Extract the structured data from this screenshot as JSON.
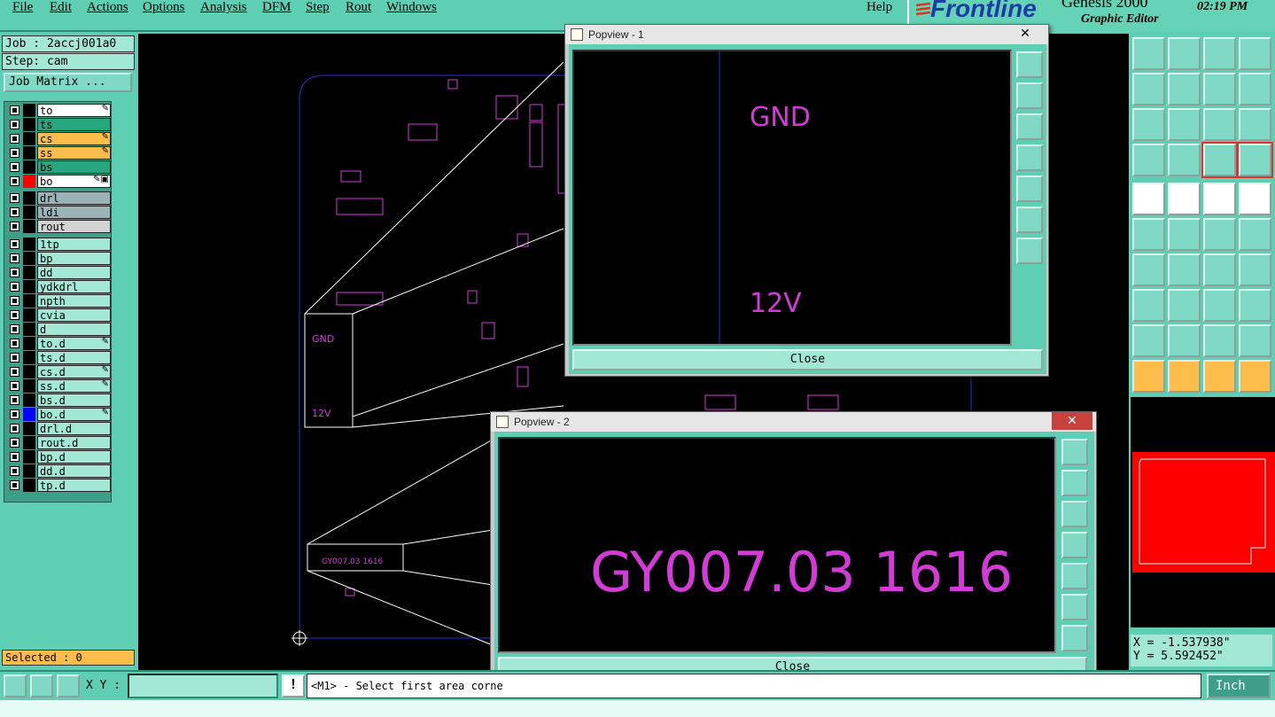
{
  "menu": {
    "items": [
      "File",
      "Edit",
      "Actions",
      "Options",
      "Analysis",
      "DFM",
      "Step",
      "Rout",
      "Windows"
    ],
    "help": "Help"
  },
  "brand": {
    "logo": "Frontline",
    "product": "Genesis 2000",
    "subtitle": "Graphic Editor",
    "time": "02:19 PM"
  },
  "job": {
    "job_label": "Job : 2accj001a0",
    "step_label": "Step: cam",
    "matrix_button": "Job Matrix ..."
  },
  "layers": [
    {
      "name": "to",
      "color": "#ffffff",
      "bg": "#ffffff",
      "tag": "✎"
    },
    {
      "name": "ts",
      "color": "#ffffff",
      "bg": "#25a67d",
      "tag": ""
    },
    {
      "name": "cs",
      "color": "#ffffff",
      "bg": "#fdbd4a",
      "tag": "✎"
    },
    {
      "name": "ss",
      "color": "#ffffff",
      "bg": "#fdbd4a",
      "tag": "✎"
    },
    {
      "name": "bs",
      "color": "#ffffff",
      "bg": "#25a67d",
      "tag": ""
    },
    {
      "name": "bo",
      "color": "#ff0000",
      "bg": "#ffffff",
      "tag": "✎▣"
    },
    {
      "name": "drl",
      "color": "#ffffff",
      "bg": "#9bb3b7",
      "tag": ""
    },
    {
      "name": "ldi",
      "color": "#ffffff",
      "bg": "#9bb3b7",
      "tag": ""
    },
    {
      "name": "rout",
      "color": "#ffffff",
      "bg": "#d3d3d3",
      "tag": ""
    },
    {
      "name": "1tp",
      "color": "#ffffff",
      "bg": "#a3e7d6",
      "tag": ""
    },
    {
      "name": "bp",
      "color": "#ffffff",
      "bg": "#a3e7d6",
      "tag": ""
    },
    {
      "name": "dd",
      "color": "#ffffff",
      "bg": "#a3e7d6",
      "tag": ""
    },
    {
      "name": "ydkdrl",
      "color": "#ffffff",
      "bg": "#a3e7d6",
      "tag": ""
    },
    {
      "name": "npth",
      "color": "#ffffff",
      "bg": "#a3e7d6",
      "tag": ""
    },
    {
      "name": "cvia",
      "color": "#ffffff",
      "bg": "#a3e7d6",
      "tag": ""
    },
    {
      "name": "d",
      "color": "#ffffff",
      "bg": "#a3e7d6",
      "tag": ""
    },
    {
      "name": "to.d",
      "color": "#ffffff",
      "bg": "#a3e7d6",
      "tag": "✎"
    },
    {
      "name": "ts.d",
      "color": "#ffffff",
      "bg": "#a3e7d6",
      "tag": ""
    },
    {
      "name": "cs.d",
      "color": "#ffffff",
      "bg": "#a3e7d6",
      "tag": "✎"
    },
    {
      "name": "ss.d",
      "color": "#ffffff",
      "bg": "#a3e7d6",
      "tag": "✎"
    },
    {
      "name": "bs.d",
      "color": "#ffffff",
      "bg": "#a3e7d6",
      "tag": ""
    },
    {
      "name": "bo.d",
      "color": "#0000ff",
      "bg": "#a3e7d6",
      "tag": "✎"
    },
    {
      "name": "drl.d",
      "color": "#ffffff",
      "bg": "#a3e7d6",
      "tag": ""
    },
    {
      "name": "rout.d",
      "color": "#ffffff",
      "bg": "#a3e7d6",
      "tag": ""
    },
    {
      "name": "bp.d",
      "color": "#ffffff",
      "bg": "#a3e7d6",
      "tag": ""
    },
    {
      "name": "dd.d",
      "color": "#ffffff",
      "bg": "#a3e7d6",
      "tag": ""
    },
    {
      "name": "tp.d",
      "color": "#ffffff",
      "bg": "#a3e7d6",
      "tag": ""
    }
  ],
  "selected": "Selected : 0",
  "canvas": {
    "callout_gnd": "GND",
    "callout_12v": "12V",
    "callout_code": "GY007.03  1616"
  },
  "popview1": {
    "title": "Popview - 1",
    "text_top": "GND",
    "text_bottom": "12V",
    "close": "Close"
  },
  "popview2": {
    "title": "Popview - 2",
    "text": "GY007.03  1616",
    "close": "Close"
  },
  "coords": {
    "x": "X = -1.537938\"",
    "y": "Y = 5.592452\""
  },
  "status": {
    "xy_label": "X Y :",
    "xy_value": "",
    "prompt": "<M1> - Select first area corne",
    "unit": "Inch"
  },
  "colors": {
    "panel": "#5ecfb2",
    "accent_orange": "#fdbd4a",
    "magenta": "#d43ad7",
    "board_outline": "#1c1cd1"
  }
}
